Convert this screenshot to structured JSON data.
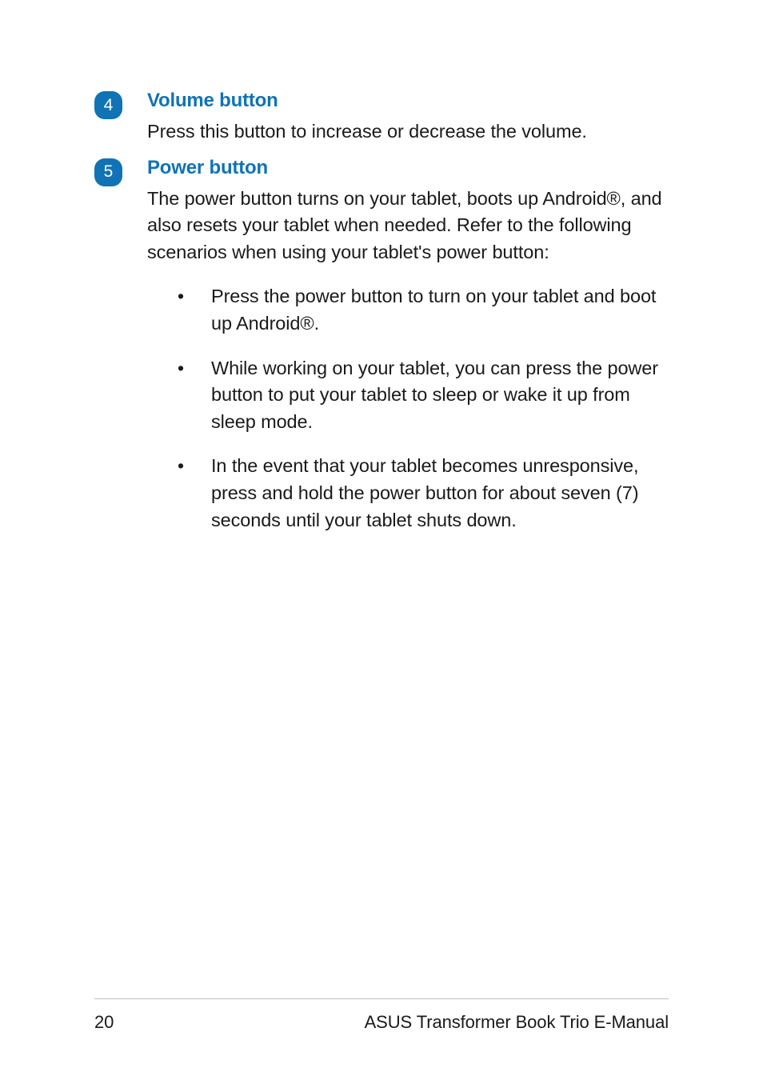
{
  "sections": [
    {
      "marker": "4",
      "heading": "Volume button",
      "body": "Press this button to increase or decrease the volume."
    },
    {
      "marker": "5",
      "heading": "Power button",
      "body": "The power button turns on your tablet, boots up Android®, and also resets your tablet when needed. Refer to the following scenarios when using your tablet's power button:",
      "bullets": [
        "Press the power button to turn on your tablet and boot up Android®.",
        "While working on your tablet, you can press the power button to put your tablet to sleep or wake it up from sleep mode.",
        "In the event that your tablet becomes unresponsive, press and hold the power button for about seven (7) seconds until your tablet shuts down."
      ]
    }
  ],
  "footer": {
    "page_number": "20",
    "doc_title": "ASUS Transformer Book Trio E-Manual"
  }
}
